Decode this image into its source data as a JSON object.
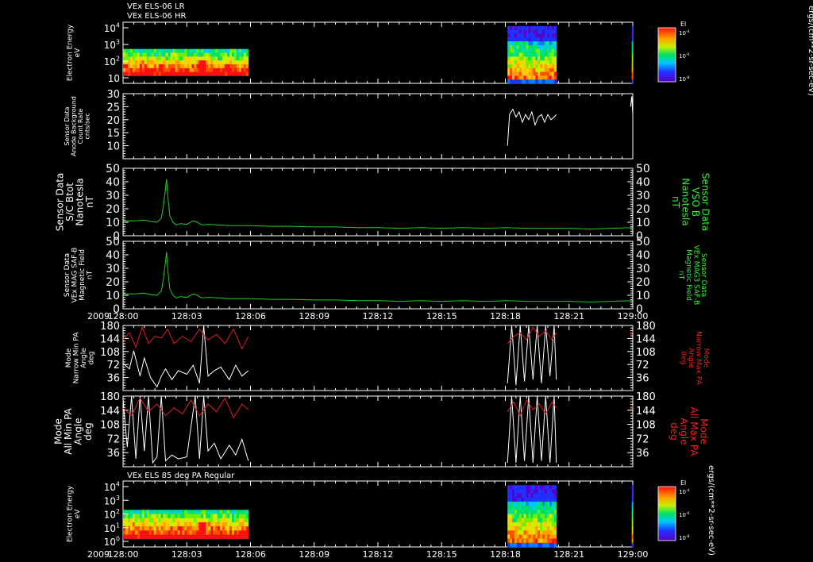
{
  "colors": {
    "background": "#000000",
    "axes": "#ffffff",
    "white_trace": "#ffffff",
    "green_trace": "#22cc22",
    "red_trace": "#dd2222",
    "green_label": "#33ee33",
    "red_label": "#ee2222"
  },
  "chart_data": {
    "type": "line",
    "year_label": "2009",
    "x_ticks": [
      "128:00",
      "128:03",
      "128:06",
      "128:09",
      "128:12",
      "128:15",
      "128:18",
      "128:21",
      "129:00"
    ],
    "xlim_minutes": [
      0,
      24
    ],
    "panels": [
      {
        "id": "spectrogram_top",
        "type": "heatmap",
        "titles": [
          "VEx ELS-06 LR",
          "VEx ELS-06 HR"
        ],
        "ylabel": [
          "Electron Energy",
          "eV"
        ],
        "yticks": [
          {
            "base": "10",
            "exp": "4"
          },
          {
            "base": "10",
            "exp": "3"
          },
          {
            "base": "10",
            "exp": "2"
          },
          {
            "base": "10",
            "exp": ""
          }
        ],
        "data_blocks_minutes": [
          [
            0,
            5.9
          ],
          [
            18.1,
            20.4
          ],
          [
            23.95,
            24
          ]
        ],
        "colorbar": {
          "title": "El",
          "ticks": [
            {
              "base": "10",
              "exp": "-4"
            },
            {
              "base": "10",
              "exp": "-6"
            },
            {
              "base": "10",
              "exp": "-8"
            }
          ],
          "units": "ergs/(cm**2-sr-sec-eV)"
        }
      },
      {
        "id": "background",
        "type": "line",
        "ylabel": [
          "Sensor Data",
          "Anode Background",
          "Count Rate",
          "cnts/sec"
        ],
        "ylim": [
          5,
          30
        ],
        "yticks": [
          "30",
          "25",
          "20",
          "15",
          "10"
        ],
        "series": [
          {
            "x": [
              18.1,
              18.2,
              18.35,
              18.5,
              18.65,
              18.8,
              18.95,
              19.1,
              19.25,
              19.4,
              19.55,
              19.7,
              19.85,
              20.0,
              20.15,
              20.3,
              20.4
            ],
            "y": [
              10,
              22,
              24,
              21,
              23,
              19,
              22,
              20,
              23,
              18,
              21,
              22,
              19,
              22,
              20,
              21,
              22
            ]
          },
          {
            "x": [
              23.9,
              23.95,
              24
            ],
            "y": [
              25,
              29,
              22
            ]
          }
        ]
      },
      {
        "id": "sc_btot",
        "type": "line",
        "ylabel": [
          "Sensor Data",
          "S/C Btot",
          "Nanotesla",
          "nT"
        ],
        "right_label": [
          "Sensor Data",
          "VSO B",
          "Nanotesla",
          "nT"
        ],
        "ylim": [
          0,
          50
        ],
        "yticks": [
          "50",
          "40",
          "30",
          "20",
          "10",
          "0"
        ],
        "series": [
          {
            "x": [
              0,
              0.5,
              1.0,
              1.3,
              1.6,
              1.8,
              1.9,
              2.0,
              2.05,
              2.1,
              2.2,
              2.35,
              2.5,
              2.7,
              3.0,
              3.3,
              3.5,
              3.7,
              4.0,
              4.5,
              5.0,
              6.0,
              7.0,
              8.0,
              9.0,
              10.0,
              11.0,
              12.0,
              13.0,
              14.0,
              15.0,
              16.0,
              17.0,
              18.0,
              19.0,
              20.0,
              21.0,
              22.0,
              23.0,
              24.0
            ],
            "y": [
              11,
              11,
              11.5,
              10.5,
              10,
              13,
              22,
              35,
              42,
              30,
              15,
              10,
              8,
              9,
              8.5,
              11,
              10,
              8,
              8.5,
              8,
              7.5,
              7.5,
              7,
              7,
              6.5,
              6.5,
              6,
              6,
              5.5,
              6,
              5.5,
              6,
              5.5,
              6,
              5.5,
              5.5,
              5.5,
              5,
              5.5,
              6
            ]
          }
        ]
      },
      {
        "id": "mag_field",
        "type": "line",
        "ylabel": [
          "Sensor Data",
          "VEx MAG SAF-B",
          "Magnetic Field",
          "nT"
        ],
        "right_label": [
          "Sensor Data",
          "VEx MAG3 SAF-B",
          "Magnetic Field",
          "nT"
        ],
        "ylim": [
          0,
          50
        ],
        "yticks": [
          "50",
          "40",
          "30",
          "20",
          "10",
          "0"
        ],
        "series": [
          {
            "x": [
              0,
              0.5,
              1.0,
              1.3,
              1.6,
              1.8,
              1.9,
              2.0,
              2.05,
              2.1,
              2.2,
              2.35,
              2.5,
              2.7,
              3.0,
              3.3,
              3.5,
              3.7,
              4.0,
              4.5,
              5.0,
              6.0,
              7.0,
              8.0,
              9.0,
              10.0,
              11.0,
              12.0,
              13.0,
              14.0,
              15.0,
              16.0,
              17.0,
              18.0,
              19.0,
              20.0,
              21.0,
              22.0,
              23.0,
              24.0
            ],
            "y": [
              11,
              11,
              11.5,
              10.5,
              10,
              13,
              22,
              35,
              42,
              30,
              15,
              10,
              8,
              9,
              8.5,
              11,
              10,
              8,
              8.5,
              8,
              7.5,
              7.5,
              7,
              7,
              6.5,
              6.5,
              6,
              6,
              5.5,
              6,
              5.5,
              6,
              5.5,
              6,
              5.5,
              5.5,
              5.5,
              5,
              5.5,
              6
            ]
          }
        ]
      },
      {
        "id": "narrow_pa",
        "type": "line",
        "ylabel": [
          "Mode",
          "Narrow Min PA",
          "Angle",
          "deg"
        ],
        "right_label": [
          "Mode",
          "Narrow Max PA",
          "Angle",
          "deg"
        ],
        "ylim": [
          0,
          180
        ],
        "yticks": [
          "180",
          "144",
          "108",
          "72",
          "36"
        ],
        "series": [
          {
            "name": "min",
            "x": [
              0,
              0.3,
              0.5,
              0.8,
              1.0,
              1.3,
              1.6,
              1.8,
              2.0,
              2.3,
              2.6,
              3.0,
              3.3,
              3.6,
              3.8,
              4.0,
              4.3,
              4.6,
              5.0,
              5.3,
              5.6,
              5.9
            ],
            "y": [
              75,
              60,
              110,
              40,
              90,
              35,
              10,
              40,
              60,
              30,
              55,
              45,
              70,
              20,
              180,
              40,
              55,
              65,
              30,
              70,
              40,
              55
            ]
          },
          {
            "name": "max",
            "x": [
              0,
              0.3,
              0.6,
              0.9,
              1.2,
              1.5,
              1.8,
              2.1,
              2.4,
              2.8,
              3.2,
              3.6,
              4.0,
              4.4,
              4.8,
              5.2,
              5.6,
              5.9
            ],
            "y": [
              140,
              160,
              120,
              175,
              130,
              150,
              145,
              170,
              130,
              150,
              135,
              170,
              140,
              155,
              130,
              170,
              115,
              150
            ]
          },
          {
            "name": "min",
            "x": [
              18.1,
              18.3,
              18.5,
              18.7,
              18.9,
              19.1,
              19.3,
              19.5,
              19.7,
              19.9,
              20.1,
              20.3,
              20.4
            ],
            "y": [
              20,
              180,
              15,
              180,
              25,
              180,
              30,
              180,
              20,
              180,
              40,
              180,
              30
            ]
          },
          {
            "name": "max",
            "x": [
              18.1,
              18.4,
              18.7,
              19.0,
              19.3,
              19.6,
              19.9,
              20.2,
              20.4
            ],
            "y": [
              130,
              150,
              160,
              140,
              175,
              150,
              165,
              140,
              160
            ]
          },
          {
            "name": "max",
            "x": [
              23.9,
              24
            ],
            "y": [
              150,
              165
            ]
          }
        ]
      },
      {
        "id": "all_pa",
        "type": "line",
        "ylabel": [
          "Mode",
          "All Min PA",
          "Angle",
          "deg"
        ],
        "right_label": [
          "Mode",
          "All Max PA",
          "Angle",
          "deg"
        ],
        "ylim": [
          0,
          180
        ],
        "yticks": [
          "180",
          "144",
          "108",
          "72",
          "36"
        ],
        "series": [
          {
            "name": "min",
            "x": [
              0,
              0.2,
              0.4,
              0.6,
              0.8,
              1.0,
              1.2,
              1.4,
              1.6,
              1.8,
              2.0,
              2.3,
              2.6,
              3.0,
              3.4,
              3.6,
              3.8,
              4.0,
              4.3,
              4.6,
              5.0,
              5.3,
              5.6,
              5.9
            ],
            "y": [
              170,
              50,
              180,
              20,
              180,
              40,
              180,
              10,
              25,
              180,
              15,
              30,
              20,
              25,
              180,
              20,
              180,
              40,
              60,
              20,
              55,
              30,
              70,
              15
            ]
          },
          {
            "name": "max",
            "x": [
              0,
              0.4,
              0.8,
              1.2,
              1.6,
              2.0,
              2.4,
              2.8,
              3.2,
              3.6,
              4.0,
              4.4,
              4.8,
              5.2,
              5.6,
              5.9
            ],
            "y": [
              150,
              130,
              175,
              140,
              160,
              130,
              150,
              135,
              170,
              130,
              160,
              140,
              175,
              125,
              160,
              145
            ]
          },
          {
            "name": "min",
            "x": [
              18.1,
              18.3,
              18.5,
              18.7,
              18.9,
              19.1,
              19.3,
              19.5,
              19.7,
              19.9,
              20.1,
              20.3,
              20.4
            ],
            "y": [
              10,
              180,
              10,
              180,
              15,
              180,
              10,
              180,
              15,
              180,
              10,
              180,
              10
            ]
          },
          {
            "name": "max",
            "x": [
              18.1,
              18.4,
              18.7,
              19.0,
              19.3,
              19.6,
              19.9,
              20.2,
              20.4
            ],
            "y": [
              140,
              165,
              130,
              170,
              145,
              160,
              135,
              165,
              150
            ]
          },
          {
            "name": "max",
            "x": [
              23.9,
              24
            ],
            "y": [
              145,
              155
            ]
          }
        ]
      },
      {
        "id": "spectrogram_bottom",
        "type": "heatmap",
        "titles": [
          "VEx ELS 85 deg PA Regular"
        ],
        "ylabel": [
          "Electron Energy",
          "eV"
        ],
        "yticks": [
          {
            "base": "10",
            "exp": "4"
          },
          {
            "base": "10",
            "exp": "3"
          },
          {
            "base": "10",
            "exp": "2"
          },
          {
            "base": "10",
            "exp": "1"
          },
          {
            "base": "10",
            "exp": "0"
          }
        ],
        "data_blocks_minutes": [
          [
            0,
            5.9
          ],
          [
            18.1,
            20.4
          ],
          [
            23.95,
            24
          ]
        ],
        "colorbar": {
          "title": "El",
          "ticks": [
            {
              "base": "10",
              "exp": "-4"
            },
            {
              "base": "10",
              "exp": "-6"
            },
            {
              "base": "10",
              "exp": "-8"
            }
          ],
          "units": "ergs/(cm**2-sr-sec-eV)"
        }
      }
    ]
  }
}
